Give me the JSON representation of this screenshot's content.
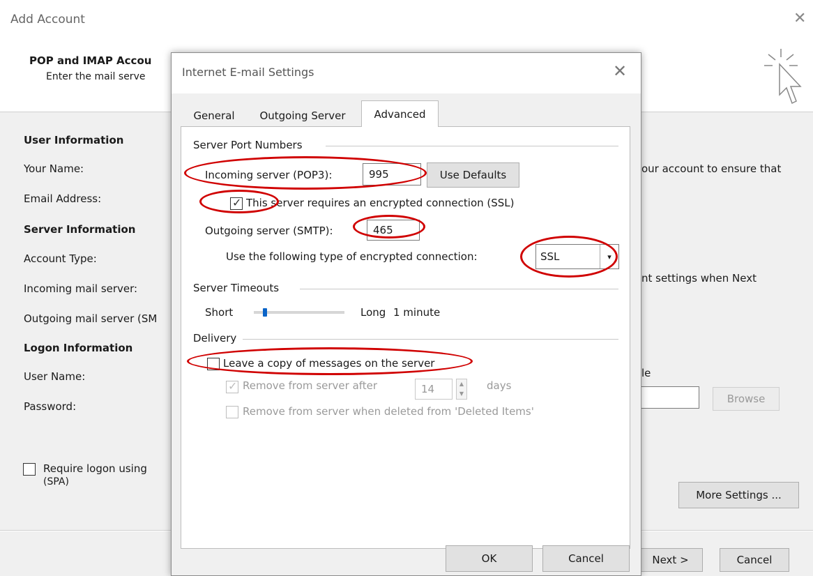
{
  "outer": {
    "title": "Add Account",
    "close": "✕",
    "header_title": "POP and IMAP Accou",
    "header_sub": "Enter the mail serve",
    "user_info": "User Information",
    "your_name_label": "Your Name:",
    "email_label": "Email Address:",
    "server_info": "Server Information",
    "account_type_label": "Account Type:",
    "incoming_label": "Incoming mail server:",
    "outgoing_label": "Outgoing mail server (SM",
    "logon_info": "Logon Information",
    "user_name_label": "User Name:",
    "password_label": "Password:",
    "require_logon": "Require logon using",
    "spa": "(SPA)",
    "right_text_1": "our account to ensure that",
    "right_text_2": "nt settings when Next",
    "right_text_3": "le",
    "browse_label": "Browse",
    "more_settings_label": "More Settings ...",
    "next_label": "Next >",
    "cancel_label": "Cancel"
  },
  "dialog": {
    "title": "Internet E-mail Settings",
    "close": "✕",
    "tabs": [
      {
        "label": "General"
      },
      {
        "label": "Outgoing Server"
      },
      {
        "label": "Advanced"
      }
    ],
    "server_port_numbers": "Server Port Numbers",
    "incoming_label": "Incoming server (POP3):",
    "incoming_value": "995",
    "use_defaults_label": "Use Defaults",
    "ssl_checkbox_label": "This server requires an encrypted connection (SSL)",
    "outgoing_label": "Outgoing server (SMTP):",
    "outgoing_value": "465",
    "encrypt_label": "Use the following type of encrypted connection:",
    "encrypt_value": "SSL",
    "server_timeouts": "Server Timeouts",
    "short_label": "Short",
    "long_label": "Long",
    "timeout_value": "1 minute",
    "timeout_fraction": 0.1,
    "delivery": "Delivery",
    "leave_copy_label": "Leave a copy of messages on the server",
    "remove_after_label": "Remove from server after",
    "remove_days_value": "14",
    "days_label": "days",
    "remove_deleted_label": "Remove from server when deleted from 'Deleted Items'",
    "ok_label": "OK",
    "cancel_label": "Cancel"
  },
  "annotation_color": "#d00000"
}
